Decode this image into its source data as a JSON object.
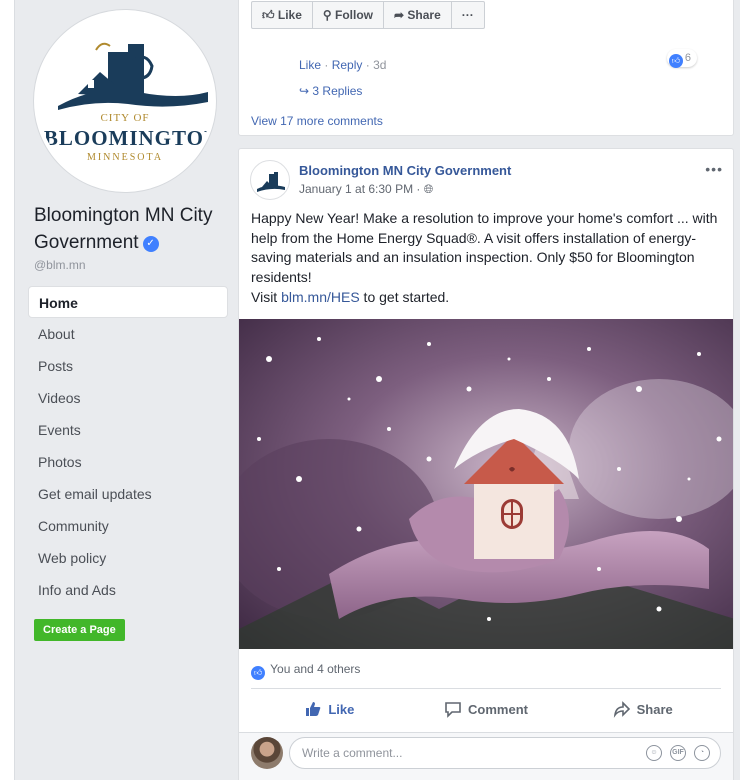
{
  "sidebar": {
    "logo": {
      "city_of": "CITY OF",
      "name": "BLOOMINGTON",
      "state": "MINNESOTA"
    },
    "page_name": "Bloomington MN City Government",
    "handle": "@blm.mn",
    "nav_items": [
      {
        "label": "Home"
      },
      {
        "label": "About"
      },
      {
        "label": "Posts"
      },
      {
        "label": "Videos"
      },
      {
        "label": "Events"
      },
      {
        "label": "Photos"
      },
      {
        "label": "Get email updates"
      },
      {
        "label": "Community"
      },
      {
        "label": "Web policy"
      },
      {
        "label": "Info and Ads"
      }
    ],
    "create_page": "Create a Page"
  },
  "top_post": {
    "buttons": {
      "like": "Like",
      "follow": "Follow",
      "share": "Share",
      "more": "···"
    },
    "comment_meta": {
      "like": "Like",
      "reply": "Reply",
      "time": "3d"
    },
    "reaction_count": "6",
    "replies": "3 Replies",
    "more_comments": "View 17 more comments"
  },
  "post": {
    "author": "Bloomington MN City Government",
    "timestamp": "January 1 at 6:30 PM",
    "more": "•••",
    "text": "Happy New Year! Make a resolution to improve your home's comfort ... with help from the Home Energy Squad®. A visit offers installation of energy-saving materials and an insulation inspection. Only $50 for Bloomington residents!",
    "link_prefix": "Visit ",
    "link": "blm.mn/HES",
    "link_suffix": " to get started.",
    "likes_summary": "You and 4 others",
    "actions": {
      "like": "Like",
      "comment": "Comment",
      "share": "Share"
    },
    "comment_placeholder": "Write a comment...",
    "comment_icons": [
      "emoji-icon",
      "gif-icon",
      "sticker-icon"
    ]
  },
  "colors": {
    "facebook_blue": "#4267b2",
    "link_blue": "#365899",
    "verified_blue": "#4080ff",
    "create_green": "#42b72a",
    "background": "#e9ebee"
  }
}
